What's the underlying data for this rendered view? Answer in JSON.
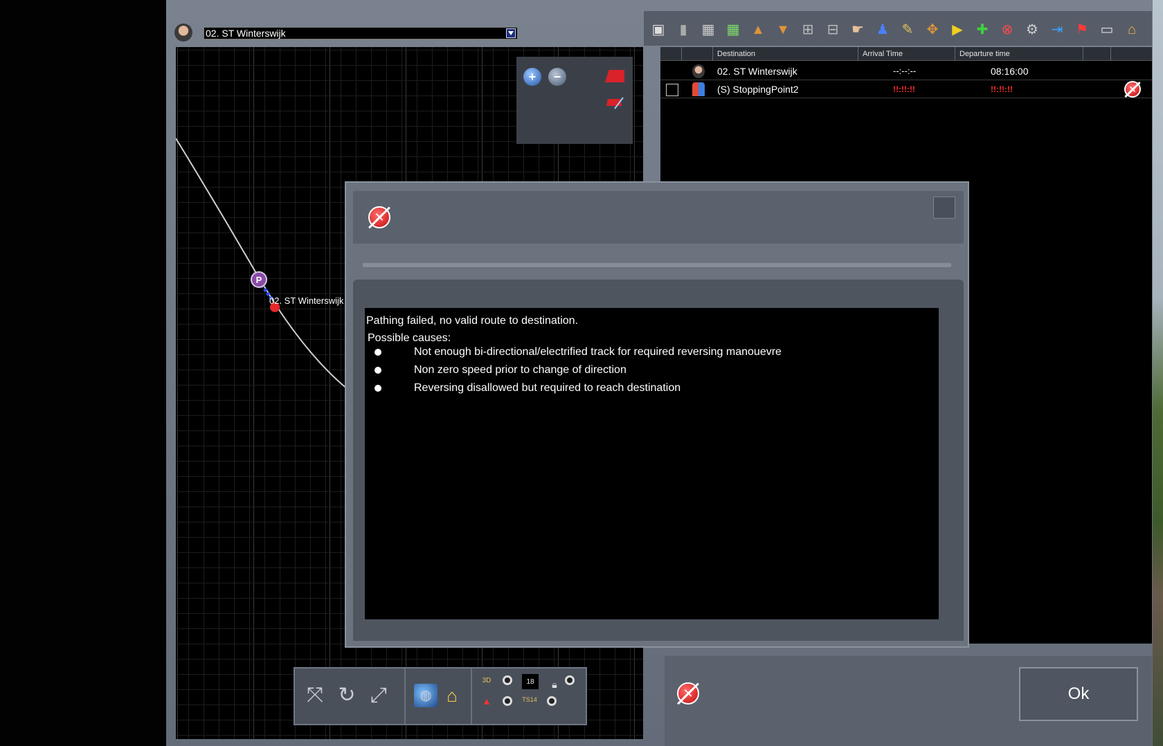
{
  "driver": {
    "selected": "02. ST Winterswijk"
  },
  "map": {
    "station_label": "02. ST Winterswijk",
    "marker_label": "P"
  },
  "map_toolbar": {
    "counter": "18",
    "small_3d": "3D",
    "small_ts": "TS14"
  },
  "schedule": {
    "columns": [
      "Destination",
      "Arrival Time",
      "Departure time"
    ],
    "rows": [
      {
        "destination": "02. ST Winterswijk",
        "arrival": "--:--:--",
        "departure": "08:16:00"
      },
      {
        "destination": "(S) StoppingPoint2",
        "arrival": "!!:!!:!!",
        "departure": "!!:!!:!!"
      }
    ]
  },
  "dialog": {
    "message": "Pathing failed, no valid route to destination.",
    "causes_heading": "Possible causes:",
    "causes": [
      "Not enough bi-directional/electrified track for required reversing manouevre",
      "Non zero speed prior to change of direction",
      "Reversing disallowed but required to reach destination"
    ]
  },
  "ok_bar": {
    "ok_label": "Ok"
  },
  "colors": {
    "panel": "#656d79",
    "error": "#d9222a",
    "text_error": "#ff2a2a"
  }
}
